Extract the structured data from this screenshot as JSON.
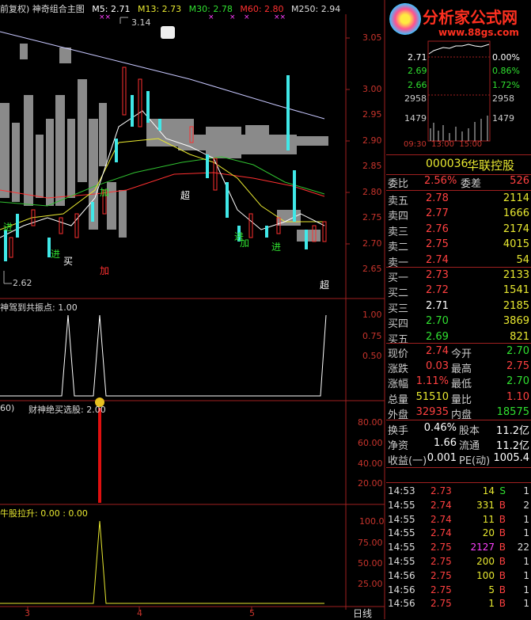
{
  "header": {
    "prefix": "前复权) 神奇组合主图",
    "ma5": "M5: 2.71",
    "ma13": "M13: 2.73",
    "ma30": "M30: 2.78",
    "ma60": "M60: 2.80",
    "ma250": "M250: 2.94"
  },
  "main_axis": [
    "3.05",
    "3.00",
    "2.95",
    "2.90",
    "2.85",
    "2.80",
    "2.75",
    "2.70",
    "2.65"
  ],
  "main_labels": {
    "hi": "3.14",
    "lo": "2.62",
    "super1": "超",
    "super2": "超",
    "add1": "加",
    "add2": "加",
    "add3": "加",
    "buy": "买",
    "in1": "进",
    "in2": "进",
    "in3": "进",
    "in4": "进"
  },
  "panel2": {
    "title": "神驾到共振点: 1.00",
    "axis": [
      "1.00",
      "0.75",
      "0.50"
    ]
  },
  "panel3": {
    "title_left": "60)",
    "title": "财神绝买选股: 2.00",
    "axis": [
      "80.00",
      "60.00",
      "40.00",
      "20.00"
    ]
  },
  "panel4": {
    "title": "牛股拉升: 0.00 : 0.00",
    "axis": [
      "100.0",
      "75.00",
      "50.00",
      "25.00"
    ]
  },
  "bottom_axis": [
    "3",
    "4",
    "5"
  ],
  "bottom_tab": "日线",
  "logo": {
    "name": "分析家公式网",
    "url": "www.88gs.com"
  },
  "mini_chart": {
    "left": [
      "2.71",
      "2.69",
      "2.66",
      "2958",
      "1479"
    ],
    "right": [
      "0.00%",
      "0.86%",
      "1.72%",
      "2958",
      "1479"
    ],
    "times": "09:30  13:00  15:00"
  },
  "stock": {
    "code": "000036",
    "name": "华联控股"
  },
  "order_ratio": {
    "label1": "委比",
    "val1": "2.56%",
    "label2": "委差",
    "val2": "526"
  },
  "asks": [
    {
      "n": "卖五",
      "p": "2.78",
      "v": "2114",
      "c": "red"
    },
    {
      "n": "卖四",
      "p": "2.77",
      "v": "1666",
      "c": "red"
    },
    {
      "n": "卖三",
      "p": "2.76",
      "v": "2174",
      "c": "red"
    },
    {
      "n": "卖二",
      "p": "2.75",
      "v": "4015",
      "c": "red"
    },
    {
      "n": "卖一",
      "p": "2.74",
      "v": "54",
      "c": "red"
    }
  ],
  "bids": [
    {
      "n": "买一",
      "p": "2.73",
      "v": "2133",
      "c": "red"
    },
    {
      "n": "买二",
      "p": "2.72",
      "v": "1541",
      "c": "red"
    },
    {
      "n": "买三",
      "p": "2.71",
      "v": "2185",
      "c": "white"
    },
    {
      "n": "买四",
      "p": "2.70",
      "v": "3869",
      "c": "green"
    },
    {
      "n": "买五",
      "p": "2.69",
      "v": "821",
      "c": "green"
    }
  ],
  "stats": [
    {
      "l1": "现价",
      "v1": "2.74",
      "c1": "red",
      "l2": "今开",
      "v2": "2.70",
      "c2": "green"
    },
    {
      "l1": "涨跌",
      "v1": "0.03",
      "c1": "red",
      "l2": "最高",
      "v2": "2.75",
      "c2": "red"
    },
    {
      "l1": "涨幅",
      "v1": "1.11%",
      "c1": "red",
      "l2": "最低",
      "v2": "2.70",
      "c2": "green"
    },
    {
      "l1": "总量",
      "v1": "51510",
      "c1": "yellow",
      "l2": "量比",
      "v2": "1.10",
      "c2": "red"
    },
    {
      "l1": "外盘",
      "v1": "32935",
      "c1": "red",
      "l2": "内盘",
      "v2": "18575",
      "c2": "green"
    }
  ],
  "stats2": [
    {
      "l1": "换手",
      "v1": "0.46%",
      "l2": "股本",
      "v2": "11.2亿"
    },
    {
      "l1": "净资",
      "v1": "1.66",
      "l2": "流通",
      "v2": "11.2亿"
    },
    {
      "l1": "收益(一)",
      "v1": "0.001",
      "l2": "PE(动)",
      "v2": "1005.4"
    }
  ],
  "ticks": [
    {
      "t": "14:53",
      "p": "2.73",
      "v": "14",
      "s": "S",
      "n": "1",
      "pc": "red",
      "vc": "yellow",
      "sc": "green"
    },
    {
      "t": "14:55",
      "p": "2.74",
      "v": "331",
      "s": "B",
      "n": "2",
      "pc": "red",
      "vc": "yellow",
      "sc": "red"
    },
    {
      "t": "14:55",
      "p": "2.74",
      "v": "11",
      "s": "B",
      "n": "1",
      "pc": "red",
      "vc": "yellow",
      "sc": "red"
    },
    {
      "t": "14:55",
      "p": "2.74",
      "v": "20",
      "s": "B",
      "n": "1",
      "pc": "red",
      "vc": "yellow",
      "sc": "red"
    },
    {
      "t": "14:55",
      "p": "2.75",
      "v": "2127",
      "s": "B",
      "n": "22",
      "pc": "red",
      "vc": "magenta",
      "sc": "red"
    },
    {
      "t": "14:55",
      "p": "2.75",
      "v": "200",
      "s": "B",
      "n": "1",
      "pc": "red",
      "vc": "yellow",
      "sc": "red"
    },
    {
      "t": "14:56",
      "p": "2.75",
      "v": "100",
      "s": "B",
      "n": "1",
      "pc": "red",
      "vc": "yellow",
      "sc": "red"
    },
    {
      "t": "14:56",
      "p": "2.75",
      "v": "5",
      "s": "B",
      "n": "1",
      "pc": "red",
      "vc": "yellow",
      "sc": "red"
    },
    {
      "t": "14:56",
      "p": "2.75",
      "v": "1",
      "s": "B",
      "n": "1",
      "pc": "red",
      "vc": "yellow",
      "sc": "red"
    }
  ]
}
